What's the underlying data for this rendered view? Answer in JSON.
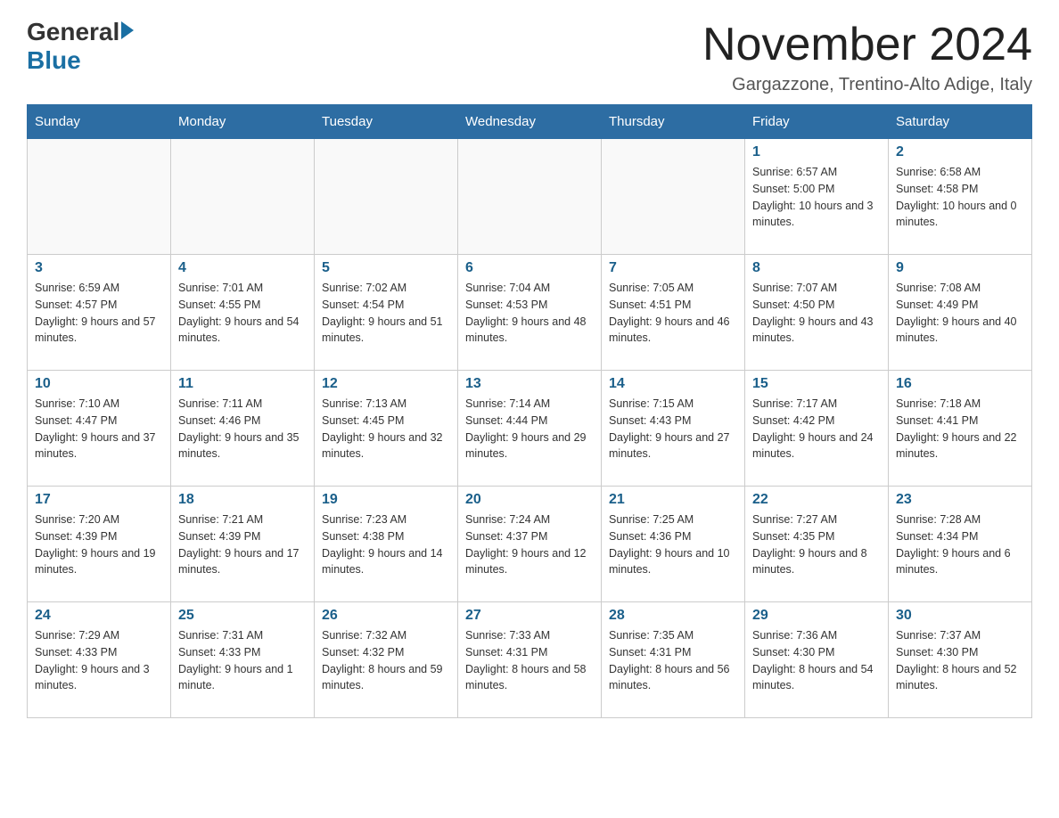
{
  "header": {
    "logo_general": "General",
    "logo_blue": "Blue",
    "month_title": "November 2024",
    "location": "Gargazzone, Trentino-Alto Adige, Italy"
  },
  "weekdays": [
    "Sunday",
    "Monday",
    "Tuesday",
    "Wednesday",
    "Thursday",
    "Friday",
    "Saturday"
  ],
  "weeks": [
    [
      {
        "day": "",
        "info": ""
      },
      {
        "day": "",
        "info": ""
      },
      {
        "day": "",
        "info": ""
      },
      {
        "day": "",
        "info": ""
      },
      {
        "day": "",
        "info": ""
      },
      {
        "day": "1",
        "info": "Sunrise: 6:57 AM\nSunset: 5:00 PM\nDaylight: 10 hours and 3 minutes."
      },
      {
        "day": "2",
        "info": "Sunrise: 6:58 AM\nSunset: 4:58 PM\nDaylight: 10 hours and 0 minutes."
      }
    ],
    [
      {
        "day": "3",
        "info": "Sunrise: 6:59 AM\nSunset: 4:57 PM\nDaylight: 9 hours and 57 minutes."
      },
      {
        "day": "4",
        "info": "Sunrise: 7:01 AM\nSunset: 4:55 PM\nDaylight: 9 hours and 54 minutes."
      },
      {
        "day": "5",
        "info": "Sunrise: 7:02 AM\nSunset: 4:54 PM\nDaylight: 9 hours and 51 minutes."
      },
      {
        "day": "6",
        "info": "Sunrise: 7:04 AM\nSunset: 4:53 PM\nDaylight: 9 hours and 48 minutes."
      },
      {
        "day": "7",
        "info": "Sunrise: 7:05 AM\nSunset: 4:51 PM\nDaylight: 9 hours and 46 minutes."
      },
      {
        "day": "8",
        "info": "Sunrise: 7:07 AM\nSunset: 4:50 PM\nDaylight: 9 hours and 43 minutes."
      },
      {
        "day": "9",
        "info": "Sunrise: 7:08 AM\nSunset: 4:49 PM\nDaylight: 9 hours and 40 minutes."
      }
    ],
    [
      {
        "day": "10",
        "info": "Sunrise: 7:10 AM\nSunset: 4:47 PM\nDaylight: 9 hours and 37 minutes."
      },
      {
        "day": "11",
        "info": "Sunrise: 7:11 AM\nSunset: 4:46 PM\nDaylight: 9 hours and 35 minutes."
      },
      {
        "day": "12",
        "info": "Sunrise: 7:13 AM\nSunset: 4:45 PM\nDaylight: 9 hours and 32 minutes."
      },
      {
        "day": "13",
        "info": "Sunrise: 7:14 AM\nSunset: 4:44 PM\nDaylight: 9 hours and 29 minutes."
      },
      {
        "day": "14",
        "info": "Sunrise: 7:15 AM\nSunset: 4:43 PM\nDaylight: 9 hours and 27 minutes."
      },
      {
        "day": "15",
        "info": "Sunrise: 7:17 AM\nSunset: 4:42 PM\nDaylight: 9 hours and 24 minutes."
      },
      {
        "day": "16",
        "info": "Sunrise: 7:18 AM\nSunset: 4:41 PM\nDaylight: 9 hours and 22 minutes."
      }
    ],
    [
      {
        "day": "17",
        "info": "Sunrise: 7:20 AM\nSunset: 4:39 PM\nDaylight: 9 hours and 19 minutes."
      },
      {
        "day": "18",
        "info": "Sunrise: 7:21 AM\nSunset: 4:39 PM\nDaylight: 9 hours and 17 minutes."
      },
      {
        "day": "19",
        "info": "Sunrise: 7:23 AM\nSunset: 4:38 PM\nDaylight: 9 hours and 14 minutes."
      },
      {
        "day": "20",
        "info": "Sunrise: 7:24 AM\nSunset: 4:37 PM\nDaylight: 9 hours and 12 minutes."
      },
      {
        "day": "21",
        "info": "Sunrise: 7:25 AM\nSunset: 4:36 PM\nDaylight: 9 hours and 10 minutes."
      },
      {
        "day": "22",
        "info": "Sunrise: 7:27 AM\nSunset: 4:35 PM\nDaylight: 9 hours and 8 minutes."
      },
      {
        "day": "23",
        "info": "Sunrise: 7:28 AM\nSunset: 4:34 PM\nDaylight: 9 hours and 6 minutes."
      }
    ],
    [
      {
        "day": "24",
        "info": "Sunrise: 7:29 AM\nSunset: 4:33 PM\nDaylight: 9 hours and 3 minutes."
      },
      {
        "day": "25",
        "info": "Sunrise: 7:31 AM\nSunset: 4:33 PM\nDaylight: 9 hours and 1 minute."
      },
      {
        "day": "26",
        "info": "Sunrise: 7:32 AM\nSunset: 4:32 PM\nDaylight: 8 hours and 59 minutes."
      },
      {
        "day": "27",
        "info": "Sunrise: 7:33 AM\nSunset: 4:31 PM\nDaylight: 8 hours and 58 minutes."
      },
      {
        "day": "28",
        "info": "Sunrise: 7:35 AM\nSunset: 4:31 PM\nDaylight: 8 hours and 56 minutes."
      },
      {
        "day": "29",
        "info": "Sunrise: 7:36 AM\nSunset: 4:30 PM\nDaylight: 8 hours and 54 minutes."
      },
      {
        "day": "30",
        "info": "Sunrise: 7:37 AM\nSunset: 4:30 PM\nDaylight: 8 hours and 52 minutes."
      }
    ]
  ]
}
